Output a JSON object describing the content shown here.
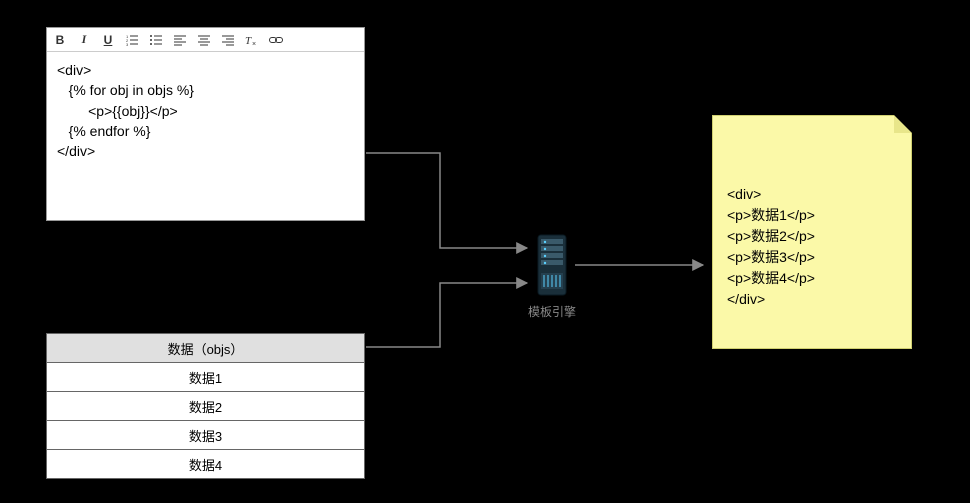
{
  "editor": {
    "code": "<div>\n   {% for obj in objs %}\n        <p>{{obj}}</p>\n   {% endfor %}\n</div>"
  },
  "table": {
    "header": "数据（objs）",
    "rows": [
      "数据1",
      "数据2",
      "数据3",
      "数据4"
    ]
  },
  "engine": {
    "label": "模板引擎"
  },
  "output": {
    "code": "<div>\n<p>数据1</p>\n<p>数据2</p>\n<p>数据3</p>\n<p>数据4</p>\n</div>"
  },
  "toolbar": {
    "bold": "B",
    "italic": "I",
    "underline": "U"
  }
}
